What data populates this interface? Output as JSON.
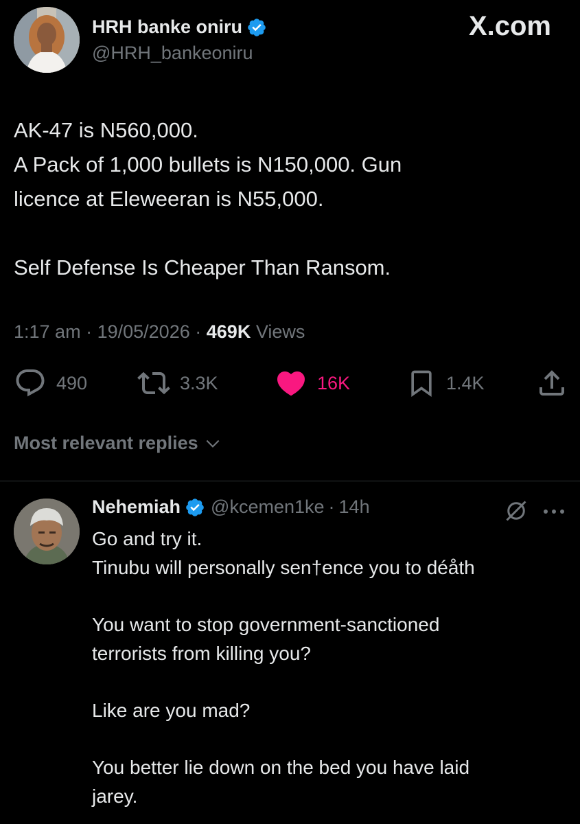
{
  "brand": {
    "label": "X.com"
  },
  "tweet": {
    "author_name": "HRH banke oniru",
    "handle": "@HRH_bankeoniru",
    "text_lines": [
      "AK-47 is N560,000.",
      "A Pack of 1,000 bullets is N150,000. Gun",
      "licence at Eleweeran is N55,000."
    ],
    "text_line_last": "Self Defense Is Cheaper Than Ransom.",
    "time": "1:17 am",
    "date": "19/05/2026",
    "separator": "·",
    "views_count": "469K",
    "views_label": "Views",
    "reply_count": "490",
    "repost_count": "3.3K",
    "like_count": "16K",
    "bookmark_count": "1.4K"
  },
  "replies_section": {
    "sort_label": "Most relevant replies"
  },
  "reply": {
    "author_name": "Nehemiah",
    "handle": "@kcemen1ke",
    "separator": "·",
    "time": "14h",
    "lines": [
      "Go and try it.",
      "Tinubu will personally sen†ence you to déåth",
      "You want to stop government-sanctioned",
      "terrorists from killing you?",
      "Like are you mad?",
      "You better lie down on the bed you have laid",
      "jarey."
    ]
  },
  "colors": {
    "background": "#000000",
    "text": "#e7e9ea",
    "secondary": "#71767b",
    "verified": "#1d9bf0",
    "like": "#f91880",
    "divider": "#2f3336"
  },
  "icons": [
    "verified-badge-icon",
    "reply-icon",
    "repost-icon",
    "heart-icon",
    "bookmark-icon",
    "share-icon",
    "chevron-down-icon",
    "grok-icon",
    "more-icon"
  ]
}
